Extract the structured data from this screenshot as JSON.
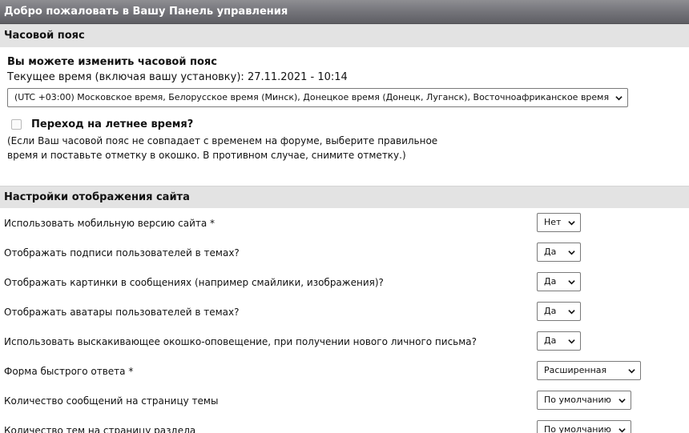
{
  "page": {
    "title": "Добро пожаловать в Вашу Панель управления"
  },
  "timezone_section": {
    "header": "Часовой пояс",
    "heading": "Вы можете изменить часовой пояс",
    "current_time_label": "Текущее время (включая вашу установку): 27.11.2021 - 10:14",
    "selected_timezone": "(UTC +03:00) Московское время, Белорусское время (Минск), Донецкое время (Донецк, Луганск), Восточноафриканское время",
    "dst_label": "Переход на летнее время?",
    "dst_checked": false,
    "note_line1": "(Если Ваш часовой пояс не совпадает с временем на форуме, выберите правильное",
    "note_line2": "время и поставьте отметку в окошко. В противном случае, снимите отметку.)"
  },
  "display_section": {
    "header": "Настройки отображения сайта",
    "rows": [
      {
        "label": "Использовать мобильную версию сайта *",
        "value": "Нет"
      },
      {
        "label": "Отображать подписи пользователей в темах?",
        "value": "Да"
      },
      {
        "label": "Отображать картинки в сообщениях (например смайлики, изображения)?",
        "value": "Да"
      },
      {
        "label": "Отображать аватары пользователей в темах?",
        "value": "Да"
      },
      {
        "label": "Использовать выскакивающее окошко-оповещение, при получении нового личного письма?",
        "value": "Да"
      },
      {
        "label": "Форма быстрого ответа *",
        "value": "Расширенная"
      },
      {
        "label": "Количество сообщений на страницу темы",
        "value": "По умолчанию"
      },
      {
        "label": "Количество тем на страницу раздела",
        "value": "По умолчанию"
      }
    ]
  },
  "icons": {
    "select_arrow": "chevron-down-icon"
  }
}
